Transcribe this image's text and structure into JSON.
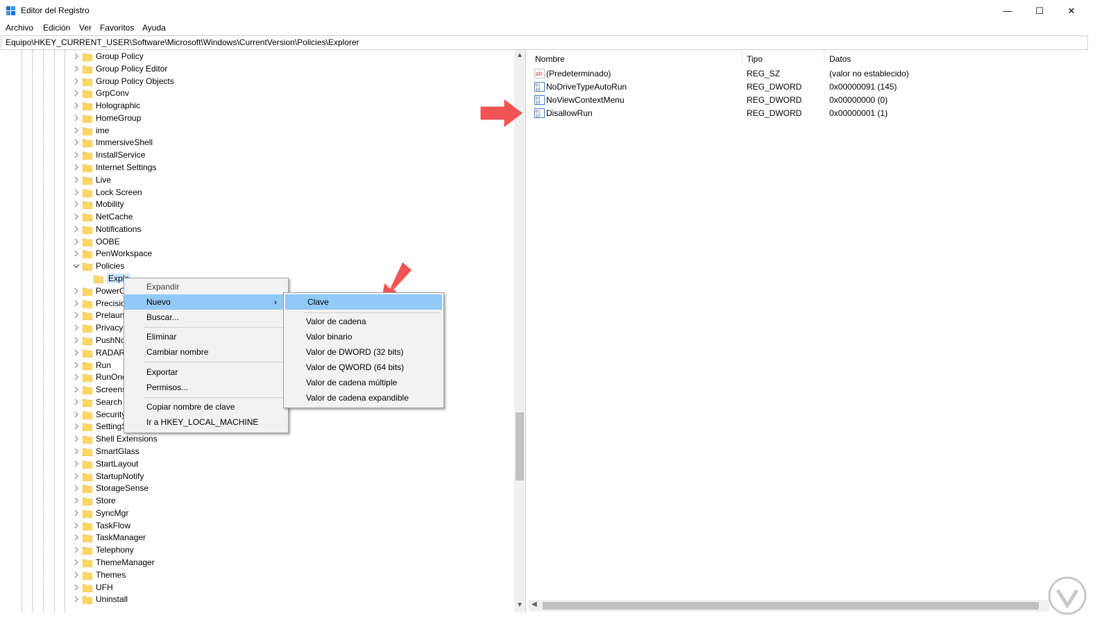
{
  "window": {
    "title": "Editor del Registro",
    "minimize_glyph": "—",
    "maximize_glyph": "☐",
    "close_glyph": "✕"
  },
  "menubar": [
    "Archivo",
    "Edición",
    "Ver",
    "Favoritos",
    "Ayuda"
  ],
  "address": "Equipo\\HKEY_CURRENT_USER\\Software\\Microsoft\\Windows\\CurrentVersion\\Policies\\Explorer",
  "tree": {
    "items": [
      "Group Policy",
      "Group Policy Editor",
      "Group Policy Objects",
      "GrpConv",
      "Holographic",
      "HomeGroup",
      "ime",
      "ImmersiveShell",
      "InstallService",
      "Internet Settings",
      "Live",
      "Lock Screen",
      "Mobility",
      "NetCache",
      "Notifications",
      "OOBE",
      "PenWorkspace",
      "Policies",
      "Explo",
      "PowerC",
      "Precisio",
      "Prelaun",
      "Privacy",
      "PushNo",
      "RADAR",
      "Run",
      "RunOnc",
      "Screens",
      "Search",
      "Security",
      "SettingS",
      "Shell Extensions",
      "SmartGlass",
      "StartLayout",
      "StartupNotify",
      "StorageSense",
      "Store",
      "SyncMgr",
      "TaskFlow",
      "TaskManager",
      "Telephony",
      "ThemeManager",
      "Themes",
      "UFH",
      "Uninstall"
    ],
    "expanded_item": "Policies",
    "selected_child": "Explo"
  },
  "values_pane": {
    "headers": {
      "name": "Nombre",
      "type": "Tipo",
      "data": "Datos"
    },
    "rows": [
      {
        "name": "(Predeterminado)",
        "type": "REG_SZ",
        "data": "(valor no establecido)",
        "icon": "string-value-icon"
      },
      {
        "name": "NoDriveTypeAutoRun",
        "type": "REG_DWORD",
        "data": "0x00000091 (145)",
        "icon": "dword-value-icon"
      },
      {
        "name": "NoViewContextMenu",
        "type": "REG_DWORD",
        "data": "0x00000000 (0)",
        "icon": "dword-value-icon"
      },
      {
        "name": "DisallowRun",
        "type": "REG_DWORD",
        "data": "0x00000001 (1)",
        "icon": "dword-value-icon"
      }
    ]
  },
  "context_menu": {
    "items": [
      "Expandir",
      "Nuevo",
      "Buscar...",
      "Eliminar",
      "Cambiar nombre",
      "Exportar",
      "Permisos...",
      "Copiar nombre de clave",
      "Ir a HKEY_LOCAL_MACHINE"
    ],
    "submenu_glyph": "›"
  },
  "submenu": {
    "items": [
      "Clave",
      "Valor de cadena",
      "Valor binario",
      "Valor de DWORD (32 bits)",
      "Valor de QWORD (64 bits)",
      "Valor de cadena múltiple",
      "Valor de cadena expandible"
    ]
  },
  "colors": {
    "highlight": "#91c9f7",
    "selection": "#cce8ff",
    "folder": "#ffd766",
    "annotation_arrow": "#f05454"
  }
}
